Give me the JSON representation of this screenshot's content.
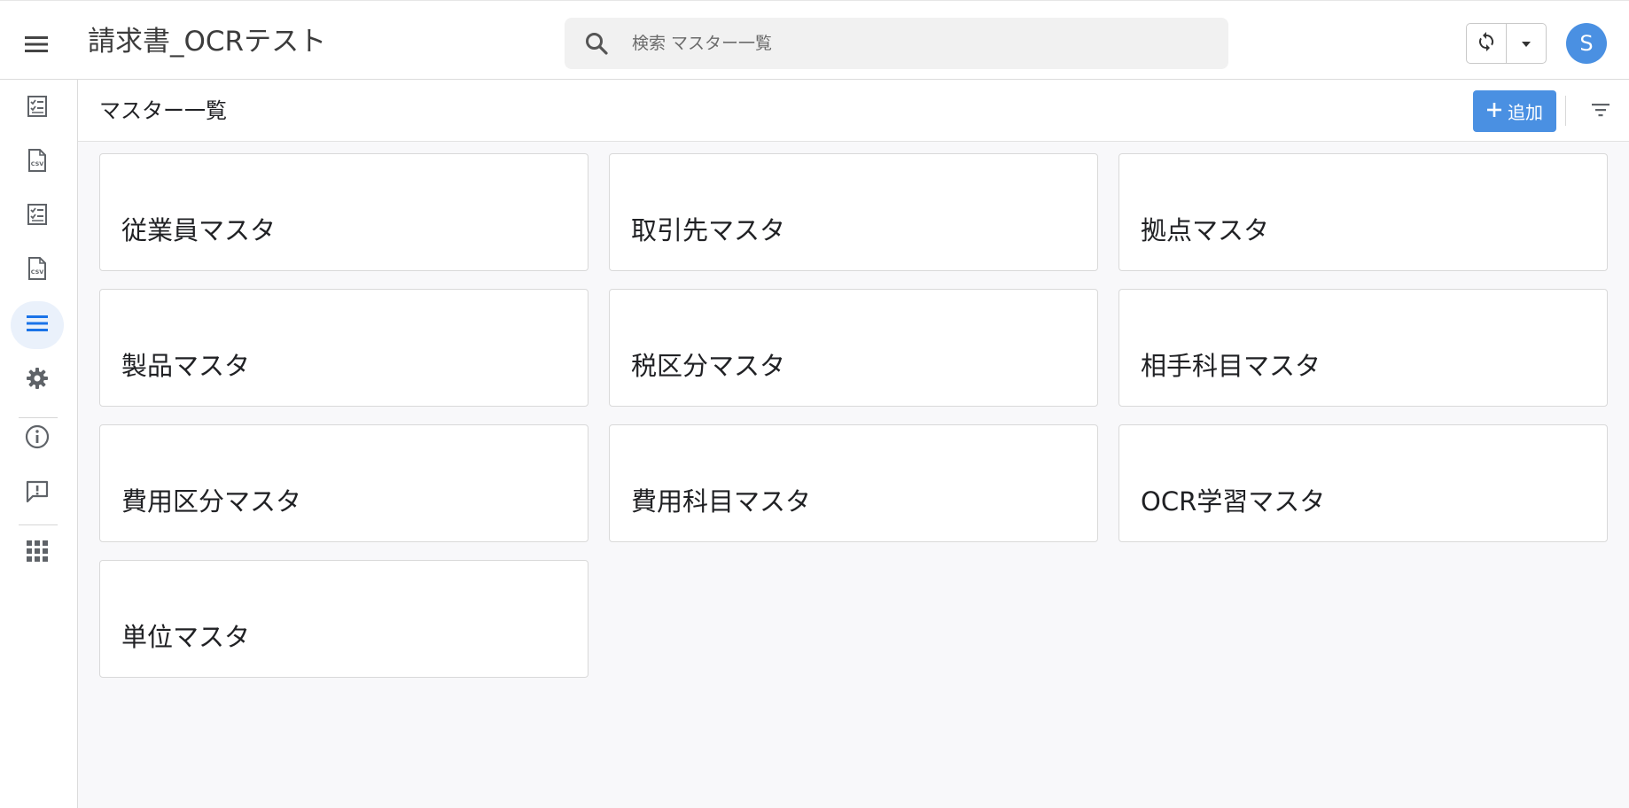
{
  "header": {
    "app_title": "請求書_OCRテスト",
    "search_placeholder": "検索 マスター一覧",
    "avatar_initial": "S"
  },
  "sidebar": {
    "items": [
      {
        "name": "checklist-icon",
        "active": false
      },
      {
        "name": "csv-file-icon",
        "active": false
      },
      {
        "name": "checklist-icon",
        "active": false
      },
      {
        "name": "csv-file-icon",
        "active": false
      },
      {
        "name": "list-icon",
        "active": true
      },
      {
        "name": "gear-icon",
        "active": false
      },
      {
        "name": "info-icon",
        "active": false
      },
      {
        "name": "feedback-icon",
        "active": false
      },
      {
        "name": "apps-grid-icon",
        "active": false
      }
    ]
  },
  "main": {
    "page_title": "マスター一覧",
    "add_label": "追加",
    "cards": [
      {
        "label": "従業員マスタ"
      },
      {
        "label": "取引先マスタ"
      },
      {
        "label": "拠点マスタ"
      },
      {
        "label": "製品マスタ"
      },
      {
        "label": "税区分マスタ"
      },
      {
        "label": "相手科目マスタ"
      },
      {
        "label": "費用区分マスタ"
      },
      {
        "label": "費用科目マスタ"
      },
      {
        "label": "OCR学習マスタ"
      },
      {
        "label": "単位マスタ"
      }
    ]
  },
  "colors": {
    "accent": "#4a90e2",
    "active_nav_bg": "#eaf1fb",
    "page_bg": "#f8f8fa"
  }
}
